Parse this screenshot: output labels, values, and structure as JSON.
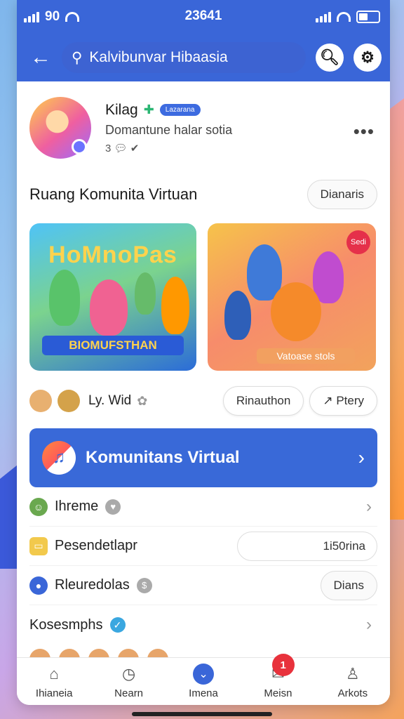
{
  "status": {
    "left_text": "90",
    "time": "23641"
  },
  "header": {
    "search_text": "Kalvibunvar Hibaasia"
  },
  "profile": {
    "name": "Kilag",
    "badge": "Lazarana",
    "subtitle": "Domantune halar sotia",
    "meta": "3"
  },
  "section": {
    "title": "Ruang Komunita Virtuan",
    "action": "Dianaris"
  },
  "cards": [
    {
      "headline": "HoMnoPas",
      "caption": "BIOMUFSTHAN"
    },
    {
      "tag": "Sedi",
      "caption": "Vatoase stols"
    }
  ],
  "actions": {
    "name": "Ly. Wid",
    "button1": "Rinauthon",
    "button2": "Ptery"
  },
  "banner": {
    "label": "Komunitans Virtual"
  },
  "list": [
    {
      "label": "Ihreme",
      "type": "chevron"
    },
    {
      "label": "Pesendetlapr",
      "value": "1i50rina",
      "type": "value"
    },
    {
      "label": "Rleuredolas",
      "pill": "Dians",
      "type": "pill"
    },
    {
      "label": "Kosesmphs",
      "type": "chevron"
    }
  ],
  "tabs": [
    {
      "label": "Ihianeia"
    },
    {
      "label": "Nearn"
    },
    {
      "label": "Imena"
    },
    {
      "label": "Meisn",
      "badge": "1"
    },
    {
      "label": "Arkots"
    }
  ]
}
